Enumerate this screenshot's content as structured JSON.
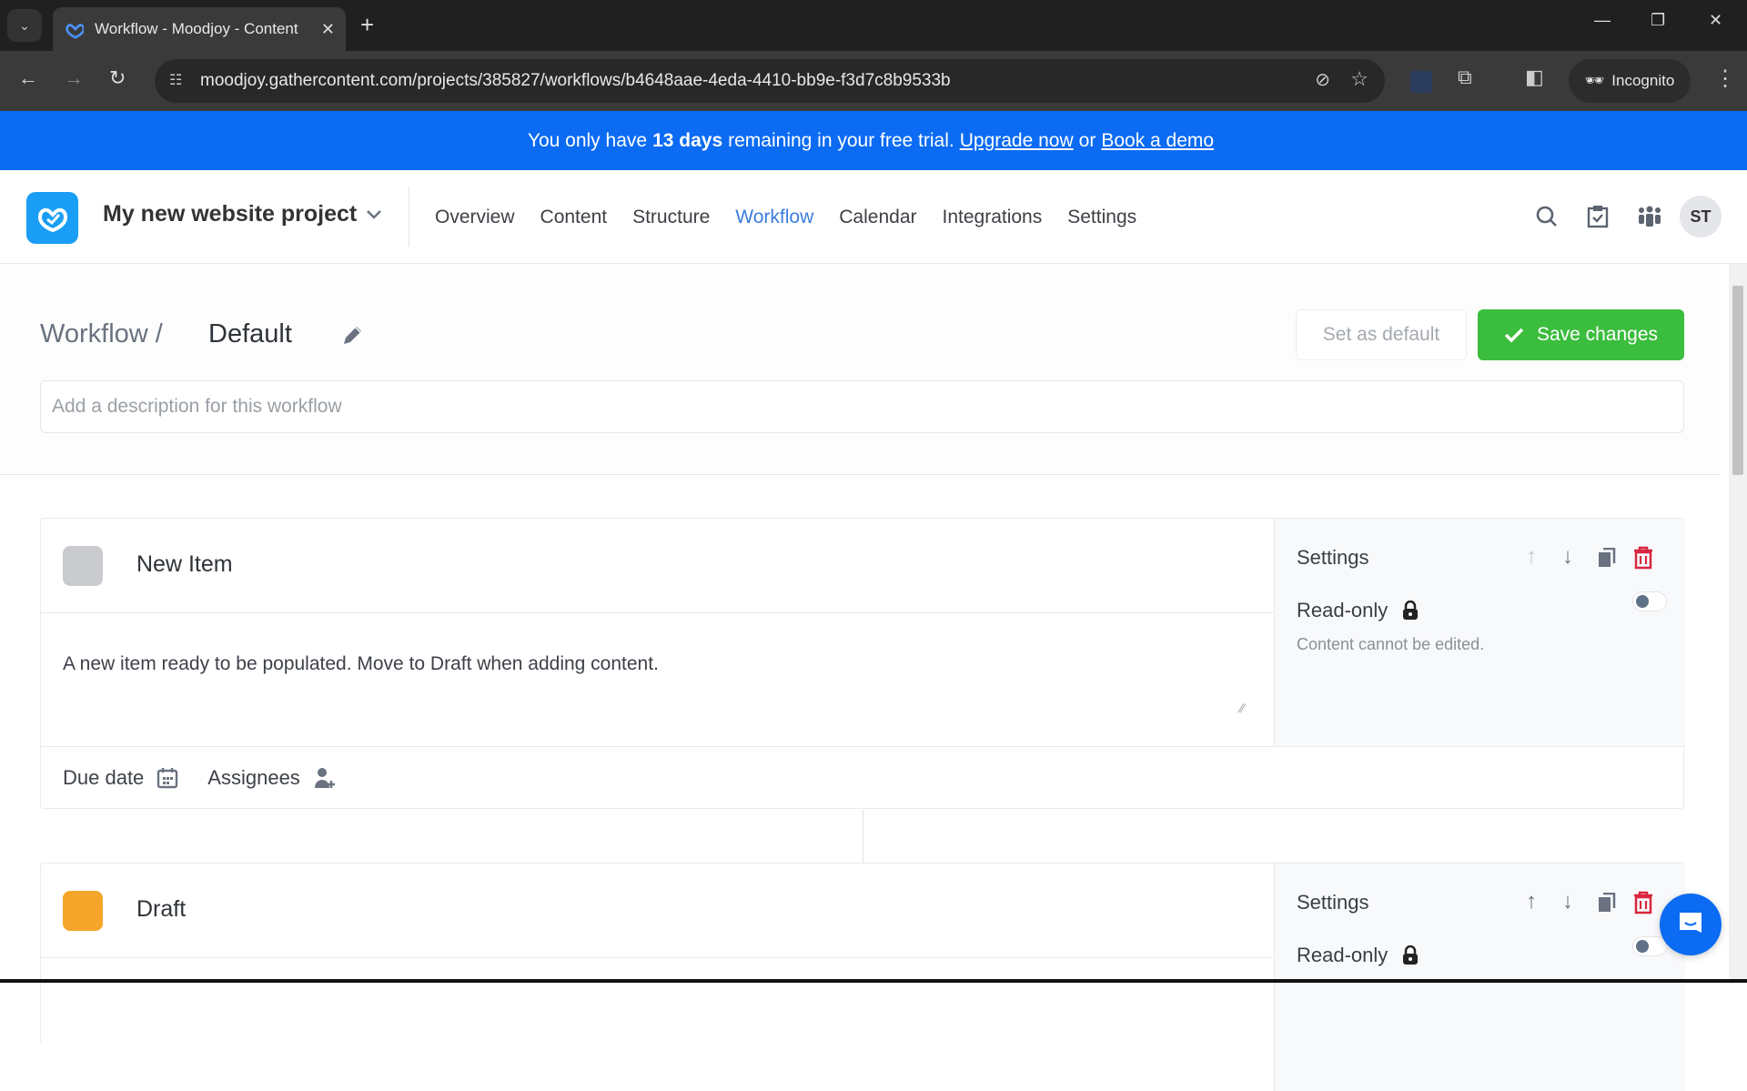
{
  "browser": {
    "tab_title": "Workflow - Moodjoy - Content",
    "url": "moodjoy.gathercontent.com/projects/385827/workflows/b4648aae-4eda-4410-bb9e-f3d7c8b9533b",
    "profile_label": "Incognito"
  },
  "banner": {
    "prefix": "You only have",
    "days": "13 days",
    "middle": "remaining in your free trial.",
    "upgrade_link": "Upgrade now",
    "or": "or",
    "demo_link": "Book a demo"
  },
  "header": {
    "project_name": "My new website project",
    "nav": [
      {
        "label": "Overview"
      },
      {
        "label": "Content"
      },
      {
        "label": "Structure"
      },
      {
        "label": "Workflow",
        "active": true
      },
      {
        "label": "Calendar"
      },
      {
        "label": "Integrations"
      },
      {
        "label": "Settings"
      }
    ],
    "avatar_initials": "ST"
  },
  "page": {
    "breadcrumb": "Workflow /",
    "workflow_name": "Default",
    "set_default_label": "Set as default",
    "save_label": "Save changes",
    "description_placeholder": "Add a description for this workflow",
    "description_value": ""
  },
  "stages": [
    {
      "name": "New Item",
      "color": "#c9cbce",
      "description": "A new item ready to be populated. Move to Draft when adding content.",
      "settings_title": "Settings",
      "readonly_label": "Read-only",
      "readonly_help": "Content cannot be edited.",
      "readonly_enabled": false,
      "due_date_label": "Due date",
      "assignees_label": "Assignees"
    },
    {
      "name": "Draft",
      "color": "#f5a62a",
      "settings_title": "Settings",
      "readonly_label": "Read-only",
      "readonly_enabled": false
    }
  ],
  "colors": {
    "brand_blue": "#0b6bf2",
    "save_green": "#3bbd3e",
    "nav_active": "#3b7dde",
    "delete_red": "#d8263e"
  }
}
